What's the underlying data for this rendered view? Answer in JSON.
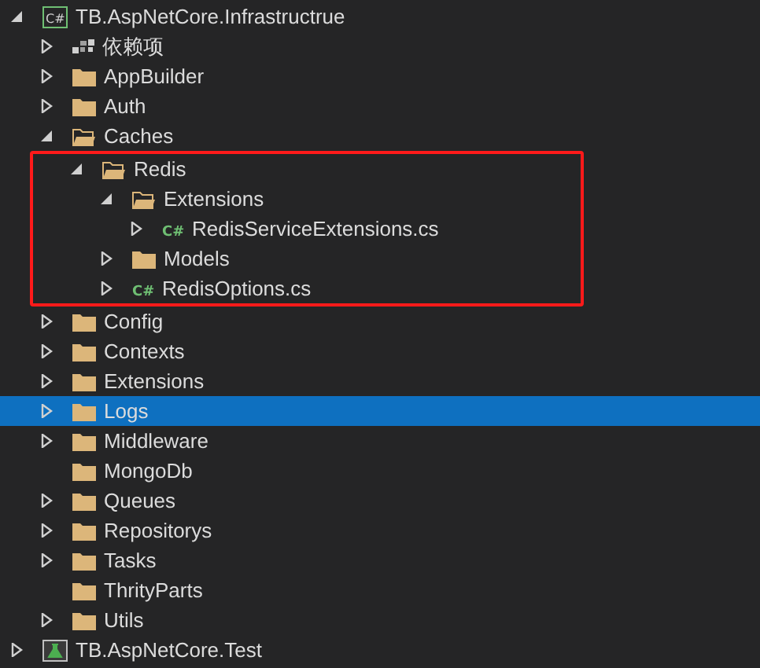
{
  "tree": [
    {
      "label": "TB.AspNetCore.Infrastructrue",
      "kind": "project",
      "icon_text": "C#",
      "expanded": true,
      "selected": false,
      "children": [
        {
          "label": "依赖项",
          "kind": "dependencies",
          "expanded": false,
          "selected": false
        },
        {
          "label": "AppBuilder",
          "kind": "folder",
          "expanded": false,
          "selected": false
        },
        {
          "label": "Auth",
          "kind": "folder",
          "expanded": false,
          "selected": false
        },
        {
          "label": "Caches",
          "kind": "folder",
          "expanded": true,
          "selected": false,
          "children": [
            {
              "label": "Redis",
              "kind": "folder",
              "expanded": true,
              "selected": false,
              "highlighted": true,
              "children": [
                {
                  "label": "Extensions",
                  "kind": "folder",
                  "expanded": true,
                  "selected": false,
                  "children": [
                    {
                      "label": "RedisServiceExtensions.cs",
                      "kind": "cs-file",
                      "icon_text": "C#",
                      "expanded": false,
                      "selected": false
                    }
                  ]
                },
                {
                  "label": "Models",
                  "kind": "folder",
                  "expanded": false,
                  "selected": false
                },
                {
                  "label": "RedisOptions.cs",
                  "kind": "cs-file",
                  "icon_text": "C#",
                  "expanded": false,
                  "selected": false
                }
              ]
            }
          ]
        },
        {
          "label": "Config",
          "kind": "folder",
          "expanded": false,
          "selected": false
        },
        {
          "label": "Contexts",
          "kind": "folder",
          "expanded": false,
          "selected": false
        },
        {
          "label": "Extensions",
          "kind": "folder",
          "expanded": false,
          "selected": false
        },
        {
          "label": "Logs",
          "kind": "folder",
          "expanded": false,
          "selected": true
        },
        {
          "label": "Middleware",
          "kind": "folder",
          "expanded": false,
          "selected": false
        },
        {
          "label": "MongoDb",
          "kind": "folder",
          "selected": false
        },
        {
          "label": "Queues",
          "kind": "folder",
          "expanded": false,
          "selected": false
        },
        {
          "label": "Repositorys",
          "kind": "folder",
          "expanded": false,
          "selected": false
        },
        {
          "label": "Tasks",
          "kind": "folder",
          "expanded": false,
          "selected": false
        },
        {
          "label": "ThrityParts",
          "kind": "folder",
          "selected": false
        },
        {
          "label": "Utils",
          "kind": "folder",
          "expanded": false,
          "selected": false
        }
      ]
    },
    {
      "label": "TB.AspNetCore.Test",
      "kind": "test-project",
      "expanded": false,
      "selected": false
    }
  ]
}
